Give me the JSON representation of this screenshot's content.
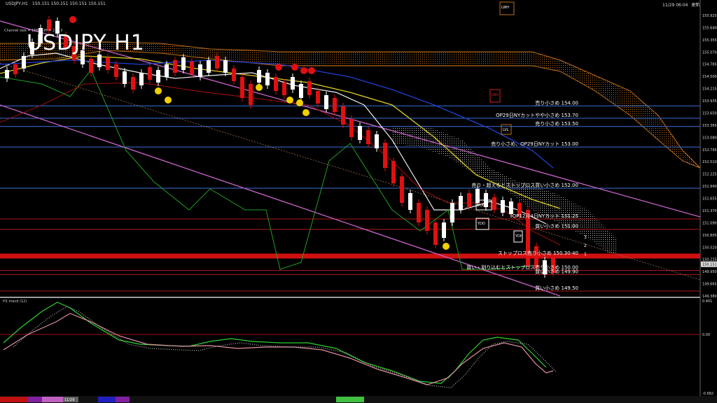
{
  "header": {
    "symbol": "USDJPY,H1",
    "ohlc": "150.151 150.151 150.151 150.151",
    "datetime": "11/29 06:04",
    "status": "更新"
  },
  "chart_title": "USDJPY H1",
  "channel_note": "Channel size = 158 Shift = 23.13",
  "macd_label": "H1 macd (12)",
  "time_label": "11/29",
  "chart_data": {
    "type": "candlestick",
    "price_axis": {
      "min": 149.38,
      "max": 156.2,
      "ticks": [
        "155.925",
        "155.640",
        "155.355",
        "155.070",
        "154.785",
        "154.500",
        "154.215",
        "153.935",
        "153.650",
        "153.365",
        "153.080",
        "152.795",
        "152.510",
        "152.225",
        "151.940",
        "151.655",
        "151.370",
        "151.090",
        "150.805",
        "150.520",
        "150.235",
        "149.950",
        "149.665",
        "149.380"
      ],
      "current_price": "150.151"
    },
    "macd_axis": {
      "max": "0.401",
      "zero": "0.00",
      "min": "-0.682"
    },
    "levels": [
      {
        "label": "売り小さめ 154.00",
        "price": 154.0,
        "color": "#3b6fd6"
      },
      {
        "label": "OP29日NYカットやや小さめ 153.70",
        "price": 153.7,
        "color": "#3b6fd6"
      },
      {
        "label": "売り小さめ 153.50",
        "price": 153.5,
        "color": "#3b6fd6"
      },
      {
        "label": "売り小さめ、OP29日NYカット 153.00",
        "price": 153.0,
        "color": "#3b6fd6"
      },
      {
        "label": "売り・超えるとストップロス買い小さめ 152.00",
        "price": 152.0,
        "color": "#3b6fd6"
      },
      {
        "label": "OP12月4日NYカット 151.25",
        "price": 151.25,
        "color": "#b01818"
      },
      {
        "label": "買い小さめ 151.00",
        "price": 151.0,
        "color": "#b01818"
      },
      {
        "label": "ストップロス売り小さめ 150.30-40",
        "price": 150.35,
        "color": "#d01010"
      },
      {
        "label": "買い・割り込むとストップロス売り小さめ 150.00",
        "price": 150.0,
        "color": "#b01818"
      },
      {
        "label": "買い小さめ 149.90",
        "price": 149.9,
        "color": "#b01818"
      },
      {
        "label": "買い小さめ 149.50",
        "price": 149.5,
        "color": "#b01818"
      }
    ],
    "boxes": [
      {
        "text": "LWH",
        "price": 156.0
      },
      {
        "text": "LW1",
        "price": 153.95
      },
      {
        "text": "LVL",
        "price": 153.15
      },
      {
        "text": "YDC",
        "price": 151.65
      },
      {
        "text": "YDO",
        "price": 151.1
      },
      {
        "text": "YDH",
        "price": 151.25
      }
    ],
    "marker_numbers": [
      "3",
      "2",
      "1"
    ],
    "series_shown": [
      "candles",
      "ichimoku cloud",
      "moving averages",
      "regression channel",
      "macd"
    ]
  },
  "colors": {
    "bull": "#ffffff",
    "bear": "#e01010",
    "cloud": "#c07018",
    "channel": "#c060c0",
    "ma_yellow": "#e0d020",
    "ma_white": "#f0f0f0",
    "ma_blue": "#2040d0",
    "chikou": "#20a020",
    "macd_green": "#30d030",
    "macd_pink": "#e090a0"
  }
}
